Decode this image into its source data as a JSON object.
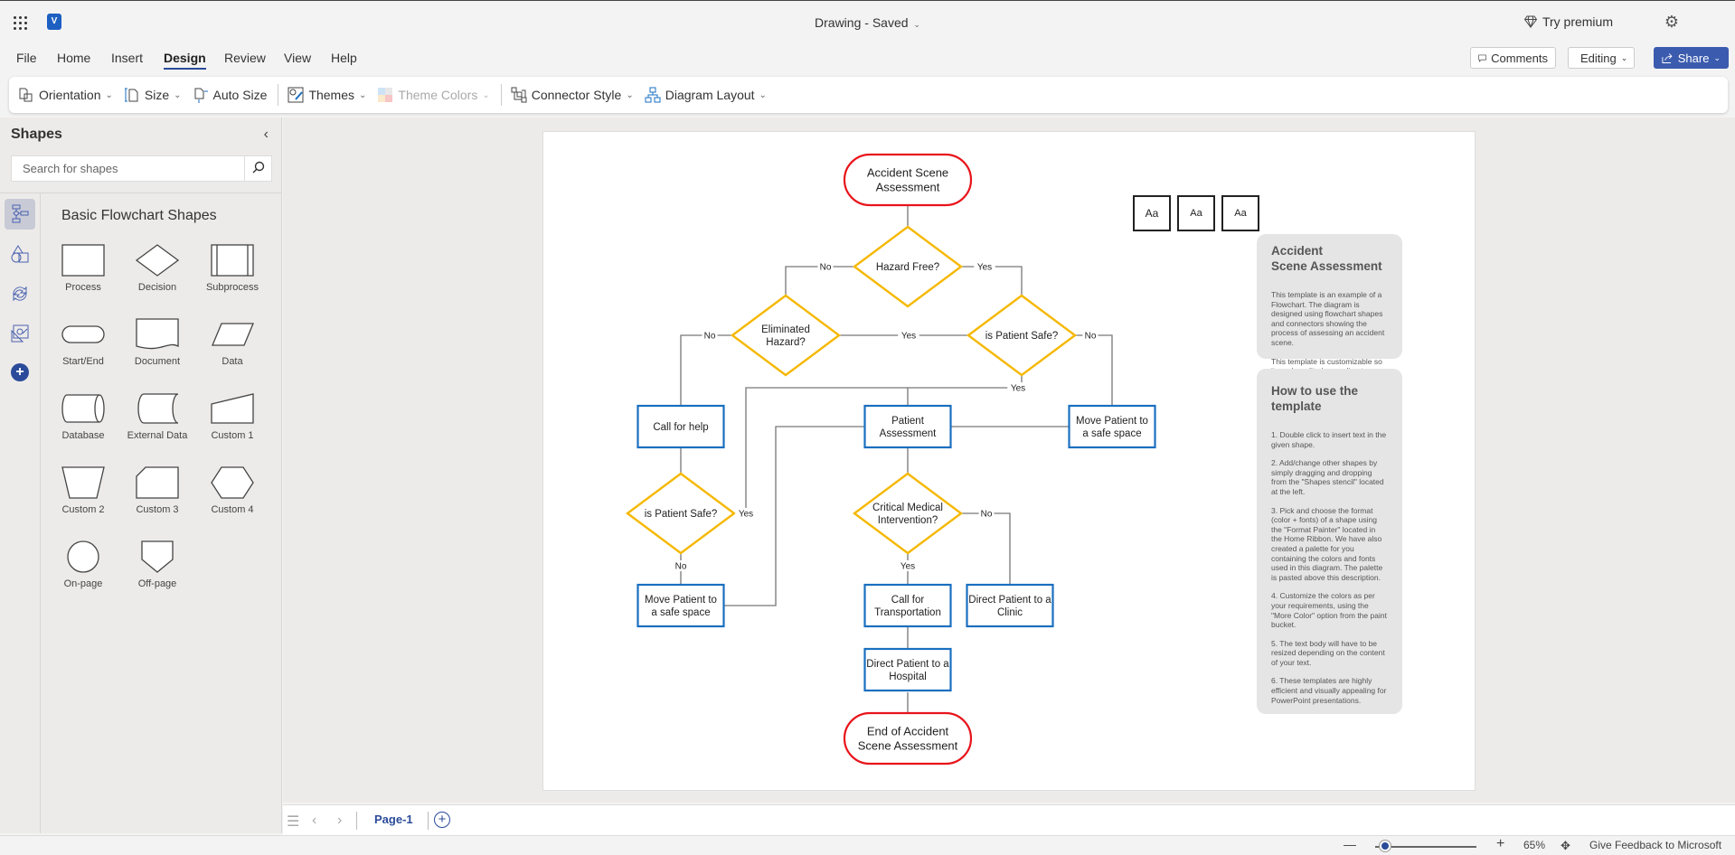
{
  "app": {
    "title": "Drawing",
    "save_status": "Saved",
    "premium_label": "Try premium"
  },
  "menu": {
    "items": [
      "File",
      "Home",
      "Insert",
      "Design",
      "Review",
      "View",
      "Help"
    ],
    "active": "Design"
  },
  "header_buttons": {
    "comments": "Comments",
    "editing": "Editing",
    "share": "Share"
  },
  "ribbon": {
    "orientation": "Orientation",
    "size": "Size",
    "auto_size": "Auto Size",
    "themes": "Themes",
    "theme_colors": "Theme Colors",
    "connector_style": "Connector Style",
    "diagram_layout": "Diagram Layout"
  },
  "sidebar": {
    "title": "Shapes",
    "search_placeholder": "Search for shapes",
    "stencil_title": "Basic Flowchart Shapes",
    "shapes": [
      "Process",
      "Decision",
      "Subprocess",
      "Start/End",
      "Document",
      "Data",
      "Database",
      "External Data",
      "Custom 1",
      "Custom 2",
      "Custom 3",
      "Custom 4",
      "On-page",
      "Off-page"
    ]
  },
  "colors": {
    "terminator": "#e8141b",
    "decision": "#f5b800",
    "process": "#1a6fc0",
    "accent": "#2b4b9a"
  },
  "diagram": {
    "nodes": {
      "start": [
        "Accident Scene",
        "Assessment"
      ],
      "hazard_free": [
        "Hazard Free?"
      ],
      "eliminated_hazard": [
        "Eliminated",
        "Hazard?"
      ],
      "patient_safe_1": [
        "is Patient Safe?"
      ],
      "call_help": [
        "Call for help"
      ],
      "patient_assessment": [
        "Patient",
        "Assessment"
      ],
      "move_patient_right": [
        "Move Patient to",
        "a safe space"
      ],
      "patient_safe_2": [
        "is Patient Safe?"
      ],
      "critical": [
        "Critical Medical",
        "Intervention?"
      ],
      "move_patient_left": [
        "Move Patient to",
        "a safe space"
      ],
      "call_transport": [
        "Call for",
        "Transportation"
      ],
      "clinic": [
        "Direct Patient to a",
        "Clinic"
      ],
      "hospital": [
        "Direct Patient to a",
        "Hospital"
      ],
      "end": [
        "End of Accident",
        "Scene Assessment"
      ]
    },
    "labels": {
      "hf_no": "No",
      "hf_yes": "Yes",
      "eh_no": "No",
      "eh_yes": "Yes",
      "ps1_no": "No",
      "ps1_yes": "Yes",
      "ps2_yes": "Yes",
      "ps2_no": "No",
      "cm_no": "No",
      "cm_yes": "Yes"
    }
  },
  "palette": [
    "Aa",
    "Aa",
    "Aa"
  ],
  "info_card_1": {
    "title": "Accident\nScene Assessment",
    "paragraphs": [
      "This template is an example of a Flowchart. The diagram is designed using flowchart shapes and connectors showing the process of assessing an accident scene.",
      "This template is customizable so it can be edited according to your requirement."
    ]
  },
  "info_card_2": {
    "title": "How to use the template",
    "paragraphs": [
      "1. Double click to insert text in the given shape.",
      "2. Add/change other shapes by simply dragging and dropping from the \"Shapes stencil\" located at the left.",
      "3. Pick and choose the format (color + fonts) of a shape using the \"Format Painter\" located in the Home Ribbon. We have also created a palette for you containing the colors and fonts used in this diagram. The palette is pasted above this description.",
      "4. Customize the colors as per your requirements, using the \"More Color\" option from the paint bucket.",
      "5. The text body will have to be resized depending on the content of your text.",
      "6. These templates are highly efficient and visually appealing for PowerPoint presentations."
    ]
  },
  "pages": {
    "current": "Page-1"
  },
  "status": {
    "zoom_percent": "65%",
    "zoom_level": 0.1,
    "feedback": "Give Feedback to Microsoft"
  }
}
